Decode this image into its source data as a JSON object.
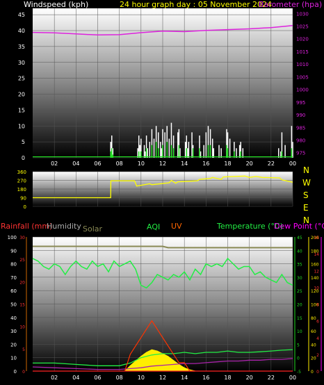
{
  "header": {
    "left_label": "Windspeed (kph)",
    "title": "24 hour graph day : 05 November 2024",
    "right_label": "Barometer (hpa)"
  },
  "direction_labels": [
    "N",
    "W",
    "S",
    "E",
    "N"
  ],
  "bottom_labels": {
    "rainfall": "Rainfall (mm)",
    "humidity": "Humidity",
    "solar": "Solar",
    "aqi": "AQI",
    "uv": "UV",
    "temperature": "Temperature (°C)",
    "dewpoint": "Dew Point (°C)"
  },
  "colors": {
    "wind": "#ffffff",
    "gust": "#ffffff",
    "windavg": "#22dd22",
    "barometer": "#dd22dd",
    "direction": "#ffff00",
    "humidity": "#8a8a55",
    "temperature": "#22ee44",
    "dewpoint": "#aa22aa",
    "solar": "#ffee00",
    "uv": "#ff3300",
    "rain": "#cc6600",
    "temp_axis": "#22dd22",
    "dew_axis": "#ff00ff"
  },
  "chart_data": [
    {
      "type": "line",
      "name": "wind-barometer",
      "x_ticks": [
        "02",
        "04",
        "06",
        "08",
        "10",
        "12",
        "14",
        "16",
        "18",
        "20",
        "22",
        "00"
      ],
      "left_axis": {
        "label": "Windspeed (kph)",
        "ylim": [
          0,
          47
        ],
        "ticks": [
          0,
          5,
          10,
          15,
          20,
          25,
          30,
          35,
          40,
          45
        ]
      },
      "right_axis": {
        "label": "Barometer (hpa)",
        "ylim": [
          973,
          1032
        ],
        "ticks": [
          975,
          980,
          985,
          990,
          995,
          1000,
          1005,
          1010,
          1015,
          1020,
          1025,
          1030
        ]
      },
      "barometer": {
        "x": [
          0,
          2,
          4,
          6,
          8,
          10,
          12,
          14,
          16,
          18,
          20,
          22,
          24
        ],
        "y": [
          1022.5,
          1022.3,
          1021.9,
          1021.5,
          1021.6,
          1022.4,
          1023.0,
          1022.8,
          1023.3,
          1023.6,
          1023.9,
          1024.4,
          1025.2
        ]
      },
      "wind_gust": {
        "x": [
          7.2,
          7.3,
          7.4,
          9.7,
          9.8,
          9.9,
          10.0,
          10.3,
          10.4,
          10.5,
          10.6,
          10.8,
          11.0,
          11.2,
          11.4,
          11.6,
          11.8,
          11.9,
          12.0,
          12.2,
          12.4,
          12.6,
          12.8,
          13.0,
          13.4,
          13.5,
          13.6,
          14.1,
          14.2,
          14.3,
          14.4,
          14.7,
          14.8,
          15.4,
          15.5,
          15.8,
          16.0,
          16.2,
          16.4,
          16.6,
          16.7,
          17.2,
          17.4,
          17.9,
          18.0,
          18.2,
          18.6,
          18.8,
          19.1,
          19.2,
          19.4,
          22.7,
          22.9,
          23.0,
          23.3,
          23.9,
          24.0
        ],
        "y": [
          5,
          7,
          3,
          3,
          7,
          4,
          6,
          4,
          2,
          7,
          3,
          5,
          9,
          6,
          10,
          8,
          5,
          3,
          9,
          8,
          10,
          6,
          11,
          7,
          8,
          9,
          3,
          5,
          7,
          3,
          5,
          8,
          4,
          7,
          2,
          4,
          8,
          10,
          9,
          6,
          3,
          4,
          3,
          9,
          8,
          6,
          5,
          3,
          4,
          5,
          3,
          3,
          2,
          8,
          4,
          10,
          5
        ]
      },
      "wind_avg": {
        "x": [
          7.2,
          7.3,
          7.4,
          9.8,
          10.0,
          10.5,
          11.0,
          11.4,
          11.6,
          12.0,
          12.4,
          12.8,
          13.0,
          13.5,
          14.2,
          14.8,
          15.4,
          16.2,
          16.4,
          17.9,
          18.0,
          18.6,
          19.2,
          23.0,
          23.9
        ],
        "y": [
          2,
          3,
          1,
          2,
          2,
          3,
          4,
          5,
          3,
          4,
          5,
          4,
          3,
          4,
          3,
          3,
          3,
          4,
          4,
          4,
          3,
          2,
          2,
          2,
          3
        ]
      }
    },
    {
      "type": "line",
      "name": "wind-direction",
      "x_ticks": [
        "02",
        "04",
        "06",
        "08",
        "10",
        "12",
        "14",
        "16",
        "18",
        "20",
        "22",
        "00"
      ],
      "ylim": [
        0,
        360
      ],
      "y_ticks": [
        0,
        90,
        180,
        270,
        360
      ],
      "direction": {
        "x": [
          0,
          7.2,
          7.21,
          9.4,
          9.6,
          10.8,
          11.0,
          12.6,
          12.8,
          13.2,
          13.4,
          15.2,
          15.4,
          16.4,
          16.6,
          17.4,
          17.6,
          19.6,
          20.0,
          20.6,
          21.2,
          22.8,
          23.0,
          24.0
        ],
        "y": [
          90,
          90,
          265,
          265,
          210,
          235,
          225,
          245,
          270,
          240,
          255,
          265,
          280,
          290,
          300,
          280,
          305,
          315,
          300,
          310,
          300,
          295,
          275,
          250
        ]
      }
    },
    {
      "type": "line",
      "name": "temperature-humidity-solar",
      "x_ticks": [
        "02",
        "04",
        "06",
        "08",
        "10",
        "12",
        "14",
        "16",
        "18",
        "20",
        "22",
        "00"
      ],
      "rain_axis": {
        "label": "Rainfall (mm)",
        "ylim": [
          0,
          30
        ],
        "ticks": [
          0,
          5,
          10,
          15,
          20,
          25,
          30
        ]
      },
      "humidity_axis": {
        "label": "Humidity",
        "ylim": [
          0,
          100
        ],
        "ticks": [
          0,
          10,
          20,
          30,
          40,
          50,
          60,
          70,
          80,
          90,
          100
        ]
      },
      "temp_axis": {
        "label": "Temperature (°C)",
        "ylim": [
          -5,
          45
        ],
        "ticks": [
          -5,
          0,
          5,
          10,
          15,
          20,
          25,
          30,
          35,
          40,
          45
        ]
      },
      "dew_axis": {
        "label": "Dew Point (°C)",
        "ylim": [
          0,
          16
        ],
        "ticks": [
          0,
          2,
          4,
          6,
          8,
          10,
          12,
          14,
          16
        ]
      },
      "solar_axis": {
        "ticks": [
          0,
          20,
          40,
          60,
          80,
          100,
          120,
          140,
          160,
          180,
          200
        ]
      },
      "humidity": {
        "x": [
          0,
          4,
          6,
          7.5,
          8,
          10,
          12,
          12.5,
          14,
          16,
          18,
          20,
          22,
          24
        ],
        "y": [
          93,
          93,
          93,
          93,
          93,
          93,
          93,
          92,
          92,
          92,
          92,
          92,
          92,
          92
        ]
      },
      "temperature": {
        "x": [
          0,
          0.5,
          1,
          1.5,
          2,
          2.5,
          3,
          3.5,
          4,
          4.5,
          5,
          5.5,
          6,
          6.5,
          7,
          7.5,
          8,
          8.5,
          9,
          9.5,
          10,
          10.5,
          11,
          11.5,
          12,
          12.5,
          13,
          13.5,
          14,
          14.5,
          15,
          15.5,
          16,
          16.5,
          17,
          17.5,
          18,
          18.5,
          19,
          19.5,
          20,
          20.5,
          21,
          21.5,
          22,
          22.5,
          23,
          23.5,
          24
        ],
        "y": [
          37,
          36,
          34,
          33,
          35,
          34,
          31,
          34,
          36,
          34,
          33,
          36,
          34,
          35,
          32,
          36,
          34,
          35,
          36,
          33,
          27,
          26,
          28,
          31,
          30,
          29,
          31,
          30,
          32,
          29,
          33,
          31,
          35,
          34,
          35,
          34,
          37,
          35,
          33,
          34,
          34,
          31,
          32,
          30,
          29,
          28,
          31,
          28,
          27
        ]
      },
      "dewpoint": {
        "x": [
          0,
          2,
          4,
          6,
          8,
          9,
          10,
          11,
          12,
          13,
          14,
          15,
          16,
          17,
          18,
          19,
          20,
          21,
          22,
          23,
          24
        ],
        "y": [
          0.5,
          0.4,
          0.3,
          0.2,
          0.2,
          0.3,
          0.4,
          0.6,
          0.7,
          0.8,
          0.9,
          0.9,
          1.0,
          1.1,
          1.2,
          1.2,
          1.3,
          1.3,
          1.4,
          1.4,
          1.5
        ]
      },
      "temp_lower": {
        "x": [
          0,
          2,
          4,
          6,
          8,
          9,
          10,
          11,
          12,
          13,
          14,
          15,
          16,
          17,
          18,
          19,
          20,
          21,
          22,
          23,
          24
        ],
        "y": [
          -2,
          -2,
          -2.5,
          -3,
          -3,
          -2,
          0,
          1,
          1.5,
          1.5,
          2,
          1.5,
          2,
          2,
          2.5,
          2,
          2,
          2.2,
          2.5,
          2.8,
          3
        ]
      },
      "solar": {
        "x": [
          8.5,
          9,
          9.5,
          10,
          10.5,
          11,
          11.5,
          12,
          12.5,
          13,
          13.5,
          14,
          14.5,
          15
        ],
        "y": [
          0,
          8,
          15,
          22,
          28,
          32,
          30,
          26,
          22,
          16,
          10,
          5,
          2,
          0
        ]
      },
      "uv": {
        "x": [
          8.5,
          9,
          9.5,
          10,
          10.5,
          11,
          11.5,
          12,
          12.5,
          13,
          13.5,
          14,
          14.5,
          15
        ],
        "y": [
          0,
          2,
          3,
          4,
          5,
          6,
          5,
          4,
          3,
          2,
          1,
          1,
          0,
          0
        ]
      },
      "rain": {
        "x": [
          0,
          24
        ],
        "y": [
          0,
          0
        ]
      }
    }
  ]
}
